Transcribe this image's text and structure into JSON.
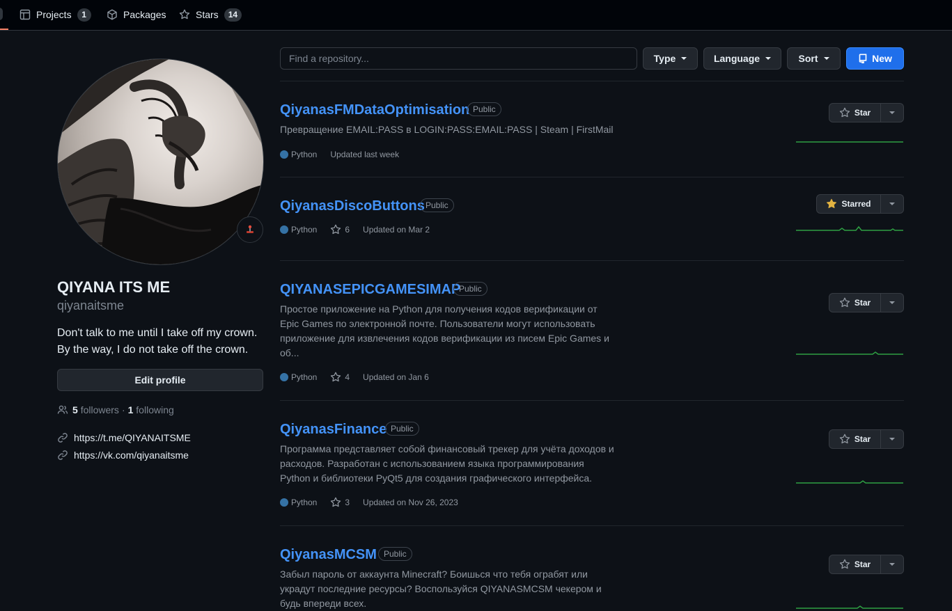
{
  "nav": {
    "tabs": [
      {
        "label": "Projects",
        "count": "1",
        "icon": "table-icon"
      },
      {
        "label": "Packages",
        "icon": "package-icon"
      },
      {
        "label": "Stars",
        "count": "14",
        "icon": "star-icon"
      }
    ]
  },
  "profile": {
    "fullname": "QIYANA ITS ME",
    "username": "qiyanaitsme",
    "bio_line1": "Don't talk to me until I take off my crown.",
    "bio_line2": "By the way, I do not take off the crown.",
    "edit_label": "Edit profile",
    "followers_count": "5",
    "followers_label": "followers",
    "separator": "·",
    "following_count": "1",
    "following_label": "following",
    "links": [
      "https://t.me/QIYANAITSME",
      "https://vk.com/qiyanaitsme"
    ]
  },
  "toolbar": {
    "search_placeholder": "Find a repository...",
    "type_label": "Type",
    "language_label": "Language",
    "sort_label": "Sort",
    "new_label": "New"
  },
  "repos": [
    {
      "name": "QiyanasFMDataOptimisation",
      "visibility": "Public",
      "description": "Превращение EMAIL:PASS в LOGIN:PASS:EMAIL:PASS | Steam | FirstMail",
      "language": "Python",
      "updated": "Updated last week",
      "star_label": "Star"
    },
    {
      "name": "QiyanasDiscoButtons",
      "visibility": "Public",
      "language": "Python",
      "stars": "6",
      "updated": "Updated on Mar 2",
      "star_label": "Starred"
    },
    {
      "name": "QIYANASEPICGAMESIMAP",
      "visibility": "Public",
      "description_lines": [
        "Простое приложение на Python для получения кодов верификации от",
        "Epic Games по электронной почте. Пользователи могут использовать",
        "приложение для извлечения кодов верификации из писем Epic Games и",
        "об..."
      ],
      "language": "Python",
      "stars": "4",
      "updated": "Updated on Jan 6",
      "star_label": "Star"
    },
    {
      "name": "QiyanasFinance",
      "visibility": "Public",
      "description_lines": [
        "Программа представляет собой финансовый трекер для учёта доходов и",
        "расходов. Разработан с использованием языка программирования",
        "Python и библиотеки PyQt5 для создания графического интерфейса."
      ],
      "language": "Python",
      "stars": "3",
      "updated": "Updated on Nov 26, 2023",
      "star_label": "Star"
    },
    {
      "name": "QiyanasMCSM",
      "visibility": "Public",
      "description_lines": [
        "Забыл пароль от аккаунта Minecraft? Боишься что тебя ограбят или",
        "украдут последние ресурсы? Воспользуйся QIYANASMCSM чекером и",
        "будь впереди всех."
      ],
      "star_label": "Star"
    }
  ],
  "colors": {
    "accent": "#4493f8",
    "primary_button": "#1f6feb",
    "python": "#3572a5",
    "starred": "#e3b341",
    "activity": "#2ea043"
  }
}
